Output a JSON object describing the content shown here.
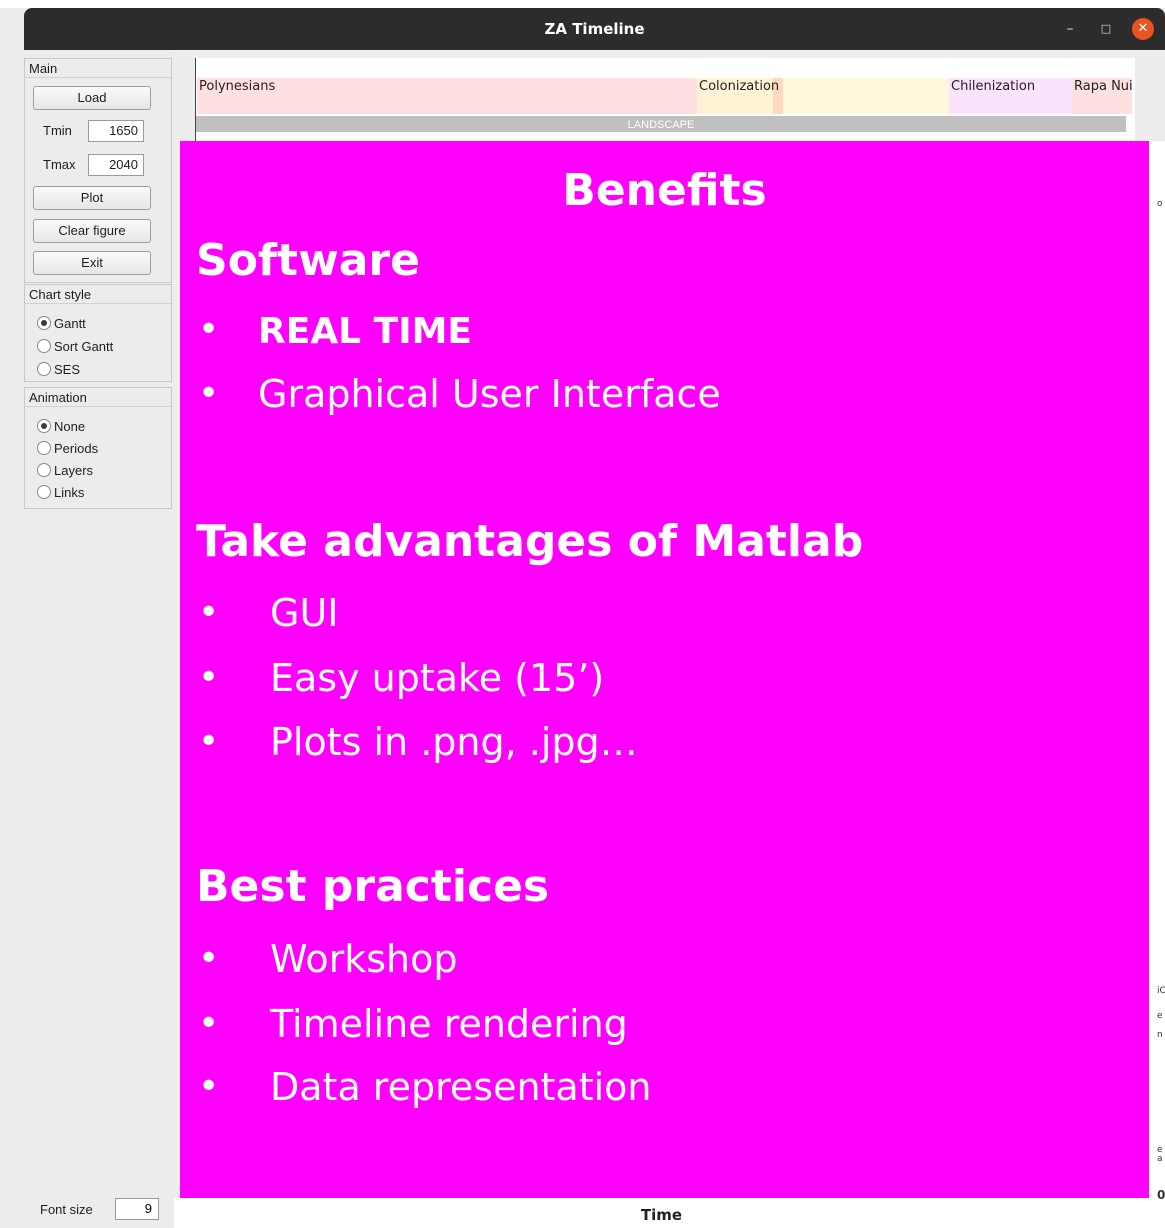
{
  "window": {
    "title": "ZA Timeline",
    "minimize_glyph": "–",
    "maximize_glyph": "□",
    "close_glyph": "✕",
    "close_color": "#e95420"
  },
  "main_panel": {
    "title": "Main",
    "load_label": "Load",
    "tmin_label": "Tmin",
    "tmin_value": "1650",
    "tmax_label": "Tmax",
    "tmax_value": "2040",
    "plot_label": "Plot",
    "clear_label": "Clear figure",
    "exit_label": "Exit"
  },
  "chart_style": {
    "title": "Chart style",
    "options": [
      {
        "label": "Gantt",
        "selected": true
      },
      {
        "label": "Sort Gantt",
        "selected": false
      },
      {
        "label": "SES",
        "selected": false
      }
    ]
  },
  "animation": {
    "title": "Animation",
    "options": [
      {
        "label": "None",
        "selected": true
      },
      {
        "label": "Periods",
        "selected": false
      },
      {
        "label": "Layers",
        "selected": false
      },
      {
        "label": "Links",
        "selected": false
      }
    ]
  },
  "timeline": {
    "periods": [
      {
        "label": "Polynesians",
        "color": "#ffe0e0"
      },
      {
        "label": "Colonization",
        "color": "#fff3d6"
      },
      {
        "label": "",
        "color": "#fff8dc"
      },
      {
        "label": "Chilenization",
        "color": "#fbe3fb"
      },
      {
        "label": "Rapa Nui",
        "color": "#ffe0e0"
      }
    ],
    "layer_label": "LANDSCAPE"
  },
  "slide": {
    "background": "#ff00ff",
    "title": "Benefits",
    "section1": "Software",
    "s1_items": [
      "REAL TIME",
      "Graphical User Interface"
    ],
    "section2": "Take advantages of Matlab",
    "s2_items": [
      "GUI",
      "Easy uptake (15’)",
      "Plots in .png, .jpg…"
    ],
    "section3": "Best practices",
    "s3_items": [
      "Workshop",
      "Timeline rendering",
      "Data representation"
    ],
    "bullet": "•"
  },
  "fragments": {
    "a": "o",
    "b": "iC",
    "c": "e",
    "d": "n",
    "e": "e",
    "f": "a",
    "g": "0"
  },
  "footer": {
    "axis_label": "Time",
    "font_size_label": "Font size",
    "font_size_value": "9"
  }
}
